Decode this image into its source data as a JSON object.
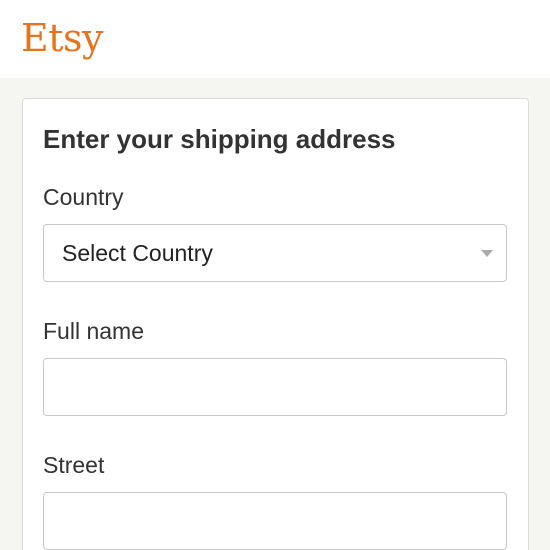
{
  "brand": {
    "logo_text": "Etsy",
    "color": "#e8731d"
  },
  "form": {
    "title": "Enter your shipping address",
    "country": {
      "label": "Country",
      "selected": "Select Country"
    },
    "full_name": {
      "label": "Full name",
      "value": "",
      "placeholder": ""
    },
    "street": {
      "label": "Street",
      "value": "",
      "placeholder": ""
    }
  },
  "icons": {
    "dropdown": "chevron-down-icon"
  }
}
